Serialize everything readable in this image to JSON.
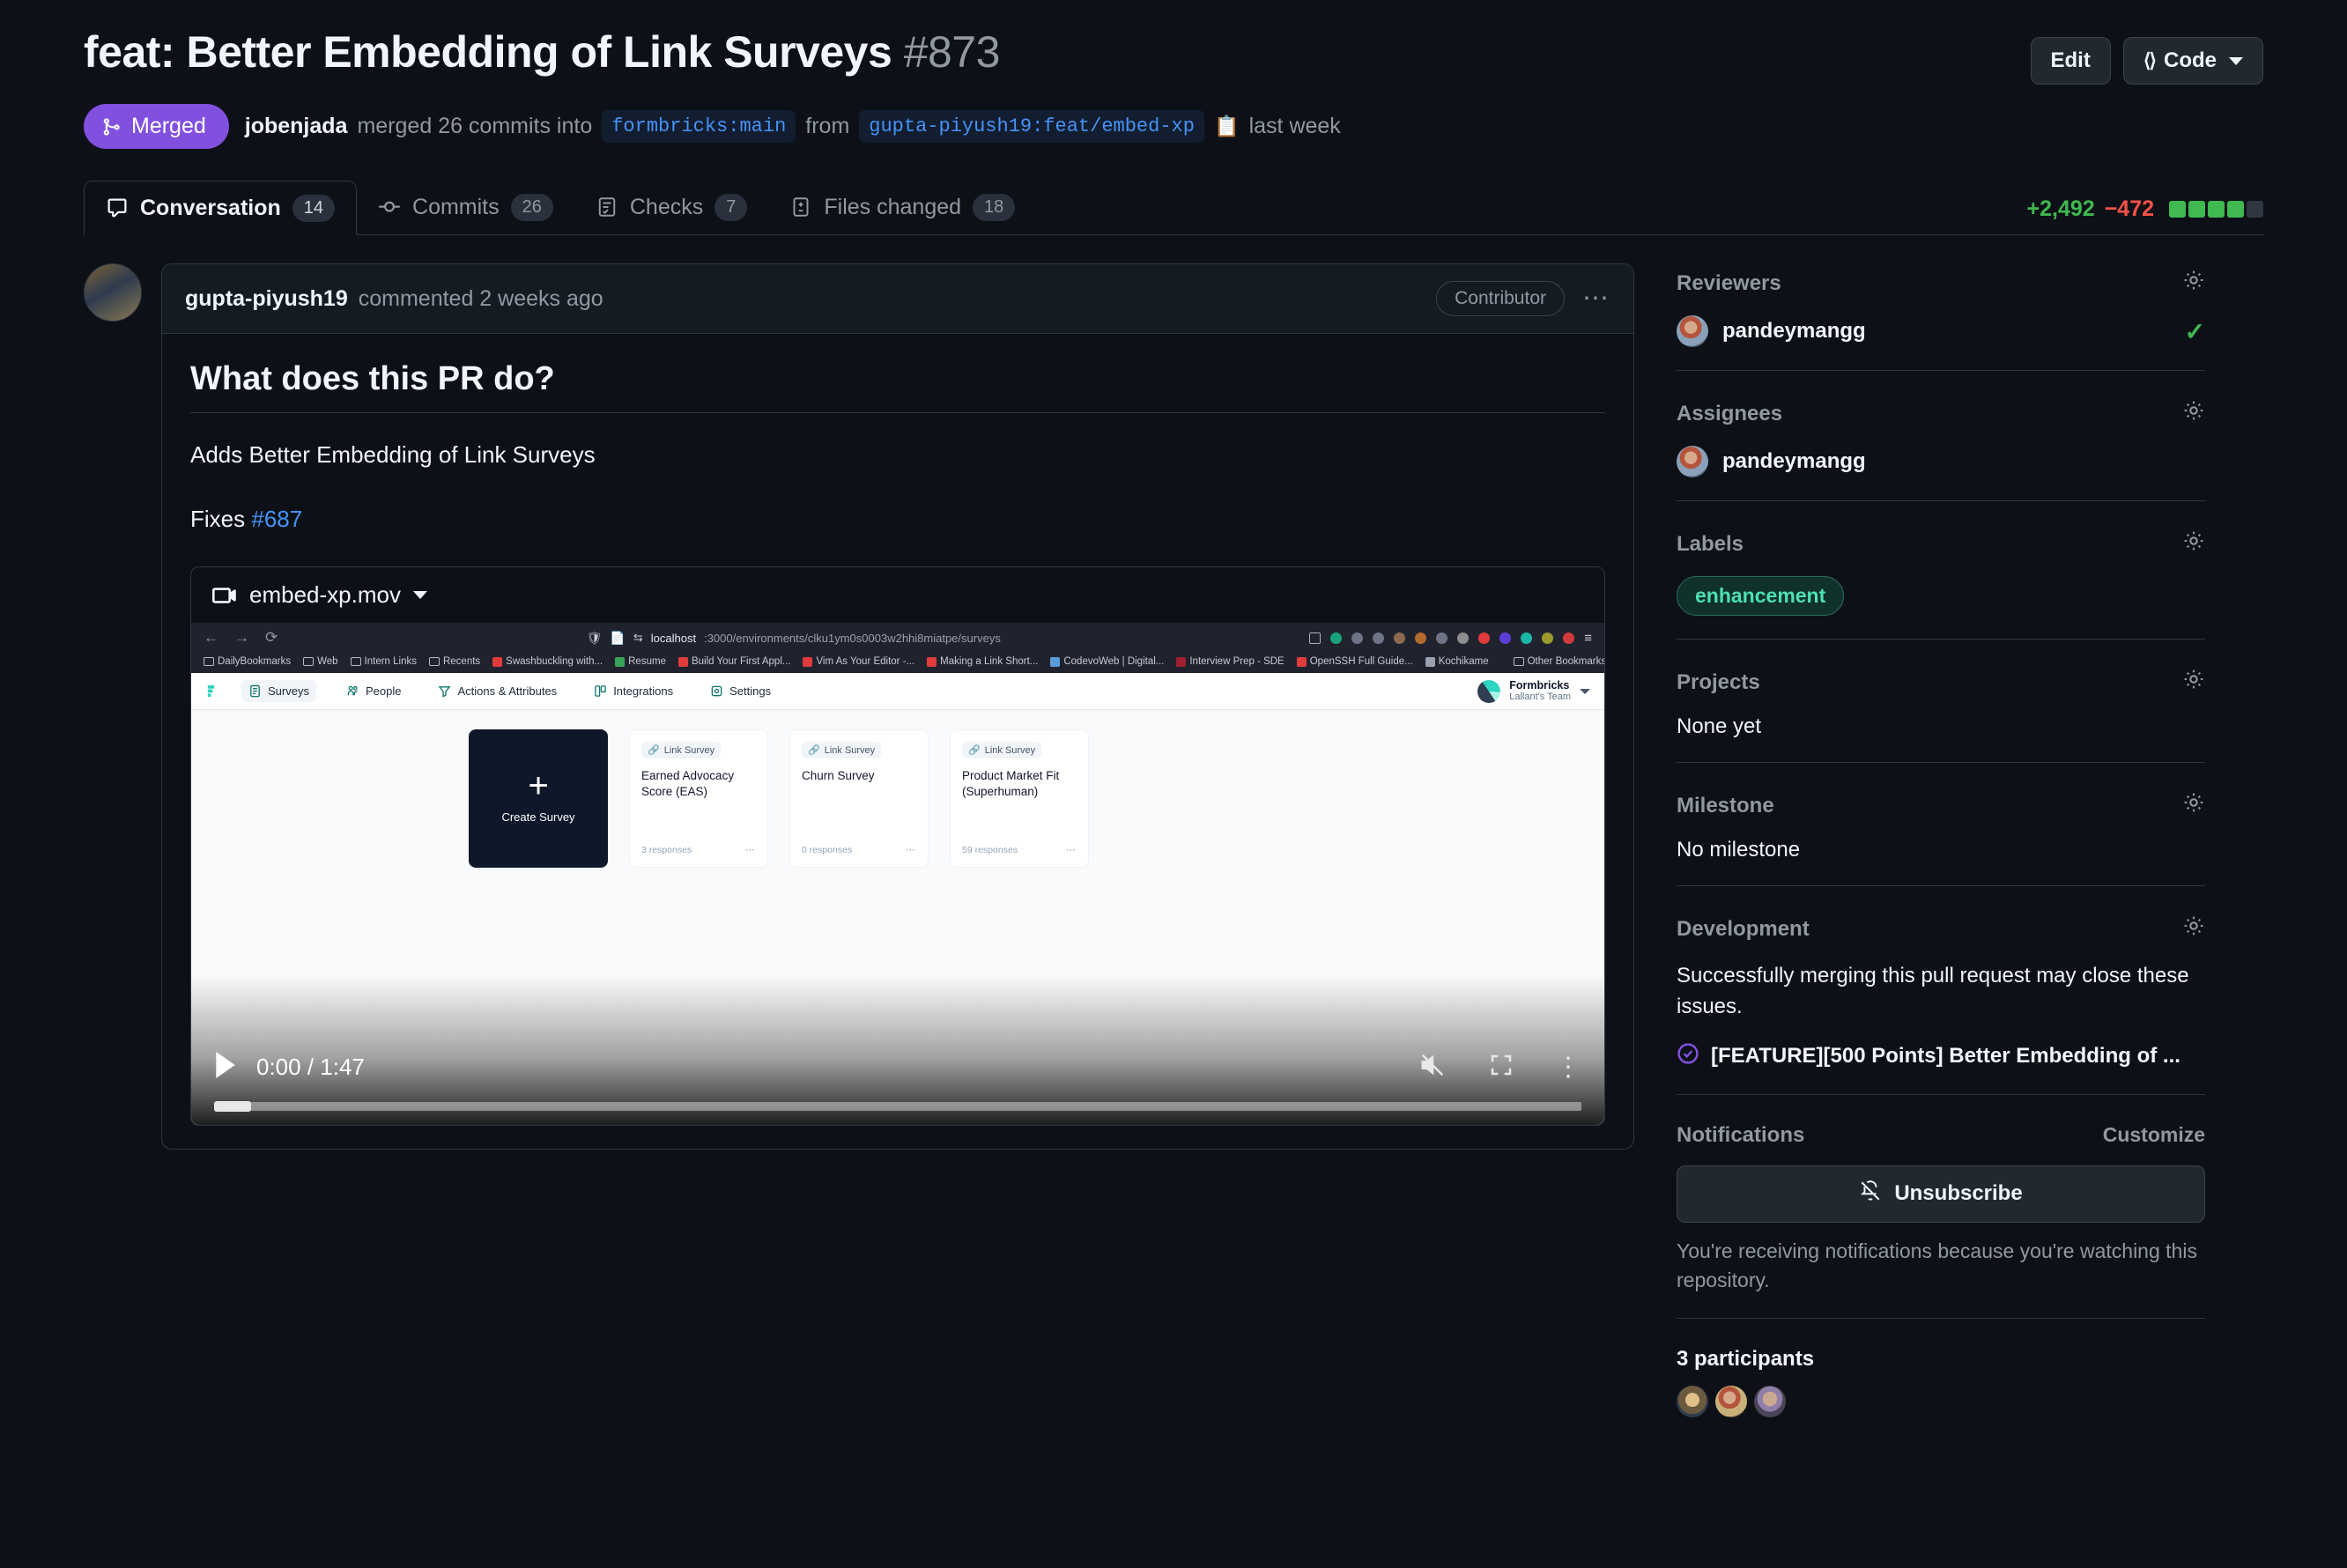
{
  "header": {
    "title": "feat: Better Embedding of Link Surveys",
    "number": "#873",
    "edit_label": "Edit",
    "code_label": "Code",
    "state": "Merged",
    "merged_by": "jobenjada",
    "merge_text_1": "merged 26 commits into",
    "base_branch": "formbricks:main",
    "merge_text_2": "from",
    "head_branch": "gupta-piyush19:feat/embed-xp",
    "merged_when": "last week"
  },
  "tabs": [
    {
      "label": "Conversation",
      "count": "14",
      "icon": "comment-icon",
      "active": true
    },
    {
      "label": "Commits",
      "count": "26",
      "icon": "commit-icon",
      "active": false
    },
    {
      "label": "Checks",
      "count": "7",
      "icon": "checks-icon",
      "active": false
    },
    {
      "label": "Files changed",
      "count": "18",
      "icon": "file-diff-icon",
      "active": false
    }
  ],
  "diffstat": {
    "additions": "+2,492",
    "deletions": "−472",
    "blocks": [
      "on",
      "on",
      "on",
      "on",
      "off"
    ]
  },
  "comment": {
    "author": "gupta-piyush19",
    "action": "commented 2 weeks ago",
    "role_badge": "Contributor",
    "heading": "What does this PR do?",
    "paragraph": "Adds Better Embedding of Link Surveys",
    "fixes_label": "Fixes",
    "fixes_issue": "#687"
  },
  "video": {
    "filename": "embed-xp.mov",
    "current_time": "0:00",
    "duration": "1:47",
    "time_display": "0:00 / 1:47",
    "browser": {
      "url_host": "localhost",
      "url_path": ":3000/environments/clku1ym0s0003w2hhi8miatpe/surveys",
      "bookmarks": [
        "DailyBookmarks",
        "Web",
        "Intern Links",
        "Recents",
        "Swashbuckling with...",
        "Resume",
        "Build Your First Appl...",
        "Vim As Your Editor -...",
        "Making a Link Short...",
        "CodevoWeb | Digital...",
        "Interview Prep - SDE",
        "OpenSSH Full Guide...",
        "Kochikame"
      ],
      "other_bookmarks": "Other Bookmarks"
    },
    "app": {
      "nav": [
        "Surveys",
        "People",
        "Actions & Attributes",
        "Integrations",
        "Settings"
      ],
      "brand_name": "Formbricks",
      "brand_team": "Lallant's Team",
      "create_label": "Create Survey",
      "surveys": [
        {
          "type": "Link Survey",
          "name": "Earned Advocacy Score (EAS)",
          "responses": "3 responses"
        },
        {
          "type": "Link Survey",
          "name": "Churn Survey",
          "responses": "0 responses"
        },
        {
          "type": "Link Survey",
          "name": "Product Market Fit (Superhuman)",
          "responses": "59 responses"
        }
      ]
    }
  },
  "sidebar": {
    "reviewers_title": "Reviewers",
    "reviewer_name": "pandeymangg",
    "assignees_title": "Assignees",
    "assignee_name": "pandeymangg",
    "labels_title": "Labels",
    "label": "enhancement",
    "projects_title": "Projects",
    "projects_value": "None yet",
    "milestone_title": "Milestone",
    "milestone_value": "No milestone",
    "development_title": "Development",
    "development_text": "Successfully merging this pull request may close these issues.",
    "development_issue": "[FEATURE][500 Points] Better Embedding of ...",
    "notifications_title": "Notifications",
    "customize_label": "Customize",
    "unsubscribe_label": "Unsubscribe",
    "notification_note": "You're receiving notifications because you're watching this repository.",
    "participants_title": "3 participants"
  },
  "colors": {
    "page_bg": "#0d1117",
    "merged_purple": "#8250df",
    "link_blue": "#4493f8",
    "added_green": "#3fb950",
    "deleted_red": "#f85149",
    "label_green": "#4ce0b3"
  }
}
